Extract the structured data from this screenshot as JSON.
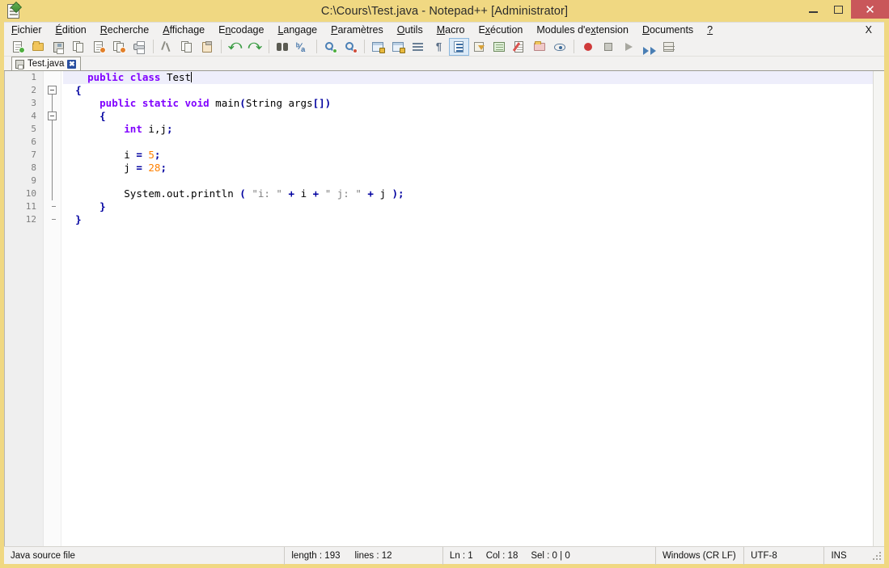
{
  "window": {
    "title": "C:\\Cours\\Test.java - Notepad++ [Administrator]",
    "icon": "notepad-plus-plus-icon",
    "minimize_label": "–",
    "maximize_label": "□",
    "close_label": "✕",
    "titlebar_color": "#f0d882",
    "close_button_color": "#c9575a"
  },
  "menubar": {
    "items": [
      {
        "label": "Fichier",
        "mnemonic": "F"
      },
      {
        "label": "Édition",
        "mnemonic": "É"
      },
      {
        "label": "Recherche",
        "mnemonic": "R"
      },
      {
        "label": "Affichage",
        "mnemonic": "A"
      },
      {
        "label": "Encodage",
        "mnemonic": "n"
      },
      {
        "label": "Langage",
        "mnemonic": "L"
      },
      {
        "label": "Paramètres",
        "mnemonic": "P"
      },
      {
        "label": "Outils",
        "mnemonic": "O"
      },
      {
        "label": "Macro",
        "mnemonic": "M"
      },
      {
        "label": "Exécution",
        "mnemonic": "x"
      },
      {
        "label": "Modules d'extension",
        "mnemonic": "x"
      },
      {
        "label": "Documents",
        "mnemonic": "D"
      },
      {
        "label": "?",
        "mnemonic": "?"
      }
    ],
    "close_document_label": "X"
  },
  "toolbar": {
    "buttons": [
      {
        "name": "new-file-icon",
        "tooltip": "Nouveau"
      },
      {
        "name": "open-file-icon",
        "tooltip": "Ouvrir"
      },
      {
        "name": "save-icon",
        "tooltip": "Enregistrer"
      },
      {
        "name": "save-all-icon",
        "tooltip": "Tout enregistrer"
      },
      {
        "name": "close-file-icon",
        "tooltip": "Fermer"
      },
      {
        "name": "close-all-icon",
        "tooltip": "Tout fermer"
      },
      {
        "name": "print-icon",
        "tooltip": "Imprimer"
      },
      {
        "name": "separator-1",
        "tooltip": ""
      },
      {
        "name": "cut-icon",
        "tooltip": "Couper"
      },
      {
        "name": "copy-icon",
        "tooltip": "Copier"
      },
      {
        "name": "paste-icon",
        "tooltip": "Coller"
      },
      {
        "name": "separator-2",
        "tooltip": ""
      },
      {
        "name": "undo-icon",
        "tooltip": "Annuler"
      },
      {
        "name": "redo-icon",
        "tooltip": "Rétablir"
      },
      {
        "name": "separator-3",
        "tooltip": ""
      },
      {
        "name": "find-icon",
        "tooltip": "Rechercher"
      },
      {
        "name": "replace-icon",
        "tooltip": "Remplacer"
      },
      {
        "name": "separator-4",
        "tooltip": ""
      },
      {
        "name": "zoom-in-icon",
        "tooltip": "Zoom avant"
      },
      {
        "name": "zoom-out-icon",
        "tooltip": "Zoom arrière"
      },
      {
        "name": "separator-5",
        "tooltip": ""
      },
      {
        "name": "sync-vertical-scroll-icon",
        "tooltip": "Synchroniser le défilement vertical"
      },
      {
        "name": "sync-horizontal-scroll-icon",
        "tooltip": "Synchroniser le défilement horizontal"
      },
      {
        "name": "word-wrap-icon",
        "tooltip": "Retour à la ligne"
      },
      {
        "name": "show-all-characters-icon",
        "tooltip": "Afficher tous les caractères"
      },
      {
        "name": "indent-guide-icon",
        "tooltip": "Guides d'indentation"
      },
      {
        "name": "user-defined-language-icon",
        "tooltip": "Langage personnalisé"
      },
      {
        "name": "document-map-icon",
        "tooltip": "Plan du document"
      },
      {
        "name": "function-list-icon",
        "tooltip": "Liste des fonctions"
      },
      {
        "name": "folder-as-workspace-icon",
        "tooltip": "Dossier comme espace de travail"
      },
      {
        "name": "monitoring-icon",
        "tooltip": "Surveillance"
      },
      {
        "name": "separator-6",
        "tooltip": ""
      },
      {
        "name": "record-macro-icon",
        "tooltip": "Démarrer l'enregistrement"
      },
      {
        "name": "stop-macro-icon",
        "tooltip": "Arrêter l'enregistrement"
      },
      {
        "name": "play-macro-icon",
        "tooltip": "Exécuter la macro"
      },
      {
        "name": "run-multiple-macro-icon",
        "tooltip": "Exécuter plusieurs fois"
      },
      {
        "name": "save-macro-icon",
        "tooltip": "Enregistrer la macro"
      }
    ],
    "active_index": 24
  },
  "tabs": [
    {
      "label": "Test.java",
      "icon": "saved-file-icon",
      "close_label": "✖",
      "active": true
    }
  ],
  "editor": {
    "line_numbers": [
      "1",
      "2",
      "3",
      "4",
      "5",
      "6",
      "7",
      "8",
      "9",
      "10",
      "11",
      "12"
    ],
    "current_line": 1,
    "lines": [
      {
        "n": 1,
        "tokens": [
          {
            "t": "    ",
            "c": "plain"
          },
          {
            "t": "public",
            "c": "kw"
          },
          {
            "t": " ",
            "c": "plain"
          },
          {
            "t": "class",
            "c": "kw"
          },
          {
            "t": " ",
            "c": "plain"
          },
          {
            "t": "Test",
            "c": "id"
          }
        ]
      },
      {
        "n": 2,
        "tokens": [
          {
            "t": "  ",
            "c": "plain"
          },
          {
            "t": "{",
            "c": "brace"
          }
        ]
      },
      {
        "n": 3,
        "tokens": [
          {
            "t": "      ",
            "c": "plain"
          },
          {
            "t": "public",
            "c": "kw"
          },
          {
            "t": " ",
            "c": "plain"
          },
          {
            "t": "static",
            "c": "kw"
          },
          {
            "t": " ",
            "c": "plain"
          },
          {
            "t": "void",
            "c": "kw"
          },
          {
            "t": " ",
            "c": "plain"
          },
          {
            "t": "main",
            "c": "id"
          },
          {
            "t": "(",
            "c": "op"
          },
          {
            "t": "String",
            "c": "id"
          },
          {
            "t": " args",
            "c": "id"
          },
          {
            "t": "[])",
            "c": "op"
          }
        ]
      },
      {
        "n": 4,
        "tokens": [
          {
            "t": "      ",
            "c": "plain"
          },
          {
            "t": "{",
            "c": "brace"
          }
        ]
      },
      {
        "n": 5,
        "tokens": [
          {
            "t": "          ",
            "c": "plain"
          },
          {
            "t": "int",
            "c": "kw"
          },
          {
            "t": " ",
            "c": "plain"
          },
          {
            "t": "i,j",
            "c": "id"
          },
          {
            "t": ";",
            "c": "op"
          }
        ]
      },
      {
        "n": 6,
        "tokens": []
      },
      {
        "n": 7,
        "tokens": [
          {
            "t": "          ",
            "c": "plain"
          },
          {
            "t": "i ",
            "c": "id"
          },
          {
            "t": "= ",
            "c": "op"
          },
          {
            "t": "5",
            "c": "num"
          },
          {
            "t": ";",
            "c": "op"
          }
        ]
      },
      {
        "n": 8,
        "tokens": [
          {
            "t": "          ",
            "c": "plain"
          },
          {
            "t": "j ",
            "c": "id"
          },
          {
            "t": "= ",
            "c": "op"
          },
          {
            "t": "28",
            "c": "num"
          },
          {
            "t": ";",
            "c": "op"
          }
        ]
      },
      {
        "n": 9,
        "tokens": []
      },
      {
        "n": 10,
        "tokens": [
          {
            "t": "          ",
            "c": "plain"
          },
          {
            "t": "System.out.println",
            "c": "id"
          },
          {
            "t": " ",
            "c": "plain"
          },
          {
            "t": "(",
            "c": "op"
          },
          {
            "t": " ",
            "c": "plain"
          },
          {
            "t": "\"i: \"",
            "c": "str"
          },
          {
            "t": " ",
            "c": "plain"
          },
          {
            "t": "+",
            "c": "op"
          },
          {
            "t": " ",
            "c": "plain"
          },
          {
            "t": "i",
            "c": "id"
          },
          {
            "t": " ",
            "c": "plain"
          },
          {
            "t": "+",
            "c": "op"
          },
          {
            "t": " ",
            "c": "plain"
          },
          {
            "t": "\" j: \"",
            "c": "str"
          },
          {
            "t": " ",
            "c": "plain"
          },
          {
            "t": "+",
            "c": "op"
          },
          {
            "t": " ",
            "c": "plain"
          },
          {
            "t": "j",
            "c": "id"
          },
          {
            "t": " ",
            "c": "plain"
          },
          {
            "t": ");",
            "c": "op"
          }
        ]
      },
      {
        "n": 11,
        "tokens": [
          {
            "t": "      ",
            "c": "plain"
          },
          {
            "t": "}",
            "c": "brace"
          }
        ]
      },
      {
        "n": 12,
        "tokens": [
          {
            "t": "  ",
            "c": "plain"
          },
          {
            "t": "}",
            "c": "brace"
          }
        ]
      }
    ],
    "fold_points": [
      2,
      4
    ],
    "colors": {
      "keyword": "#8000ff",
      "number": "#ff8000",
      "operator": "#0000a0",
      "string": "#808080",
      "identifier": "#000000",
      "current_line_bg": "#eeeefb",
      "background": "#ffffff",
      "gutter_bg": "#efefef",
      "gutter_fg": "#7d7d7d"
    }
  },
  "statusbar": {
    "file_type": "Java source file",
    "length_label": "length : 193",
    "lines_label": "lines : 12",
    "ln_label": "Ln : 1",
    "col_label": "Col : 18",
    "sel_label": "Sel : 0 | 0",
    "eol": "Windows (CR LF)",
    "encoding": "UTF-8",
    "insert_mode": "INS"
  }
}
